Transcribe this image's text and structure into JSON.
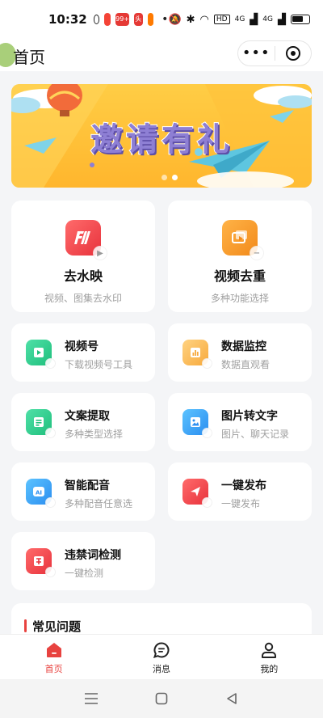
{
  "status": {
    "time": "10:32",
    "badges": [
      "99+",
      "头条"
    ],
    "network_label": "HD",
    "signal_labels": [
      "4G",
      "4G"
    ]
  },
  "nav": {
    "title": "首页",
    "more_glyph": "•••"
  },
  "banner": {
    "title": "邀请有礼",
    "slides": 2,
    "active_slide": 2
  },
  "features_big": [
    {
      "name": "去水映",
      "subtitle": "视频、图集去水印",
      "icon": "watermark-icon",
      "color": "#f0444d"
    },
    {
      "name": "视频去重",
      "subtitle": "多种功能选择",
      "icon": "video-dedup-icon",
      "color": "#f59b23"
    }
  ],
  "features_small": [
    {
      "name": "视频号",
      "subtitle": "下载视频号工具",
      "icon": "video-channel-icon",
      "color": "#2ecb8c"
    },
    {
      "name": "数据监控",
      "subtitle": "数据直观看",
      "icon": "data-monitor-icon",
      "color": "#f8b54c"
    },
    {
      "name": "文案提取",
      "subtitle": "多种类型选择",
      "icon": "text-extract-icon",
      "color": "#2ecb8c"
    },
    {
      "name": "图片转文字",
      "subtitle": "图片、聊天记录",
      "icon": "image-to-text-icon",
      "color": "#2ba3f2"
    },
    {
      "name": "智能配音",
      "subtitle": "多种配音任意选",
      "icon": "ai-voice-icon",
      "color": "#2ba3f2"
    },
    {
      "name": "一键发布",
      "subtitle": "一键发布",
      "icon": "publish-icon",
      "color": "#f0444d"
    },
    {
      "name": "违禁词检测",
      "subtitle": "一键检测",
      "icon": "forbidden-word-icon",
      "color": "#f0444d"
    }
  ],
  "faq": {
    "title": "常见问题"
  },
  "tabs": [
    {
      "label": "首页",
      "icon": "home-icon",
      "active": true
    },
    {
      "label": "消息",
      "icon": "message-icon",
      "active": false
    },
    {
      "label": "我的",
      "icon": "user-icon",
      "active": false
    }
  ],
  "colors": {
    "accent": "#e8423f",
    "background": "#f4f5f7"
  }
}
